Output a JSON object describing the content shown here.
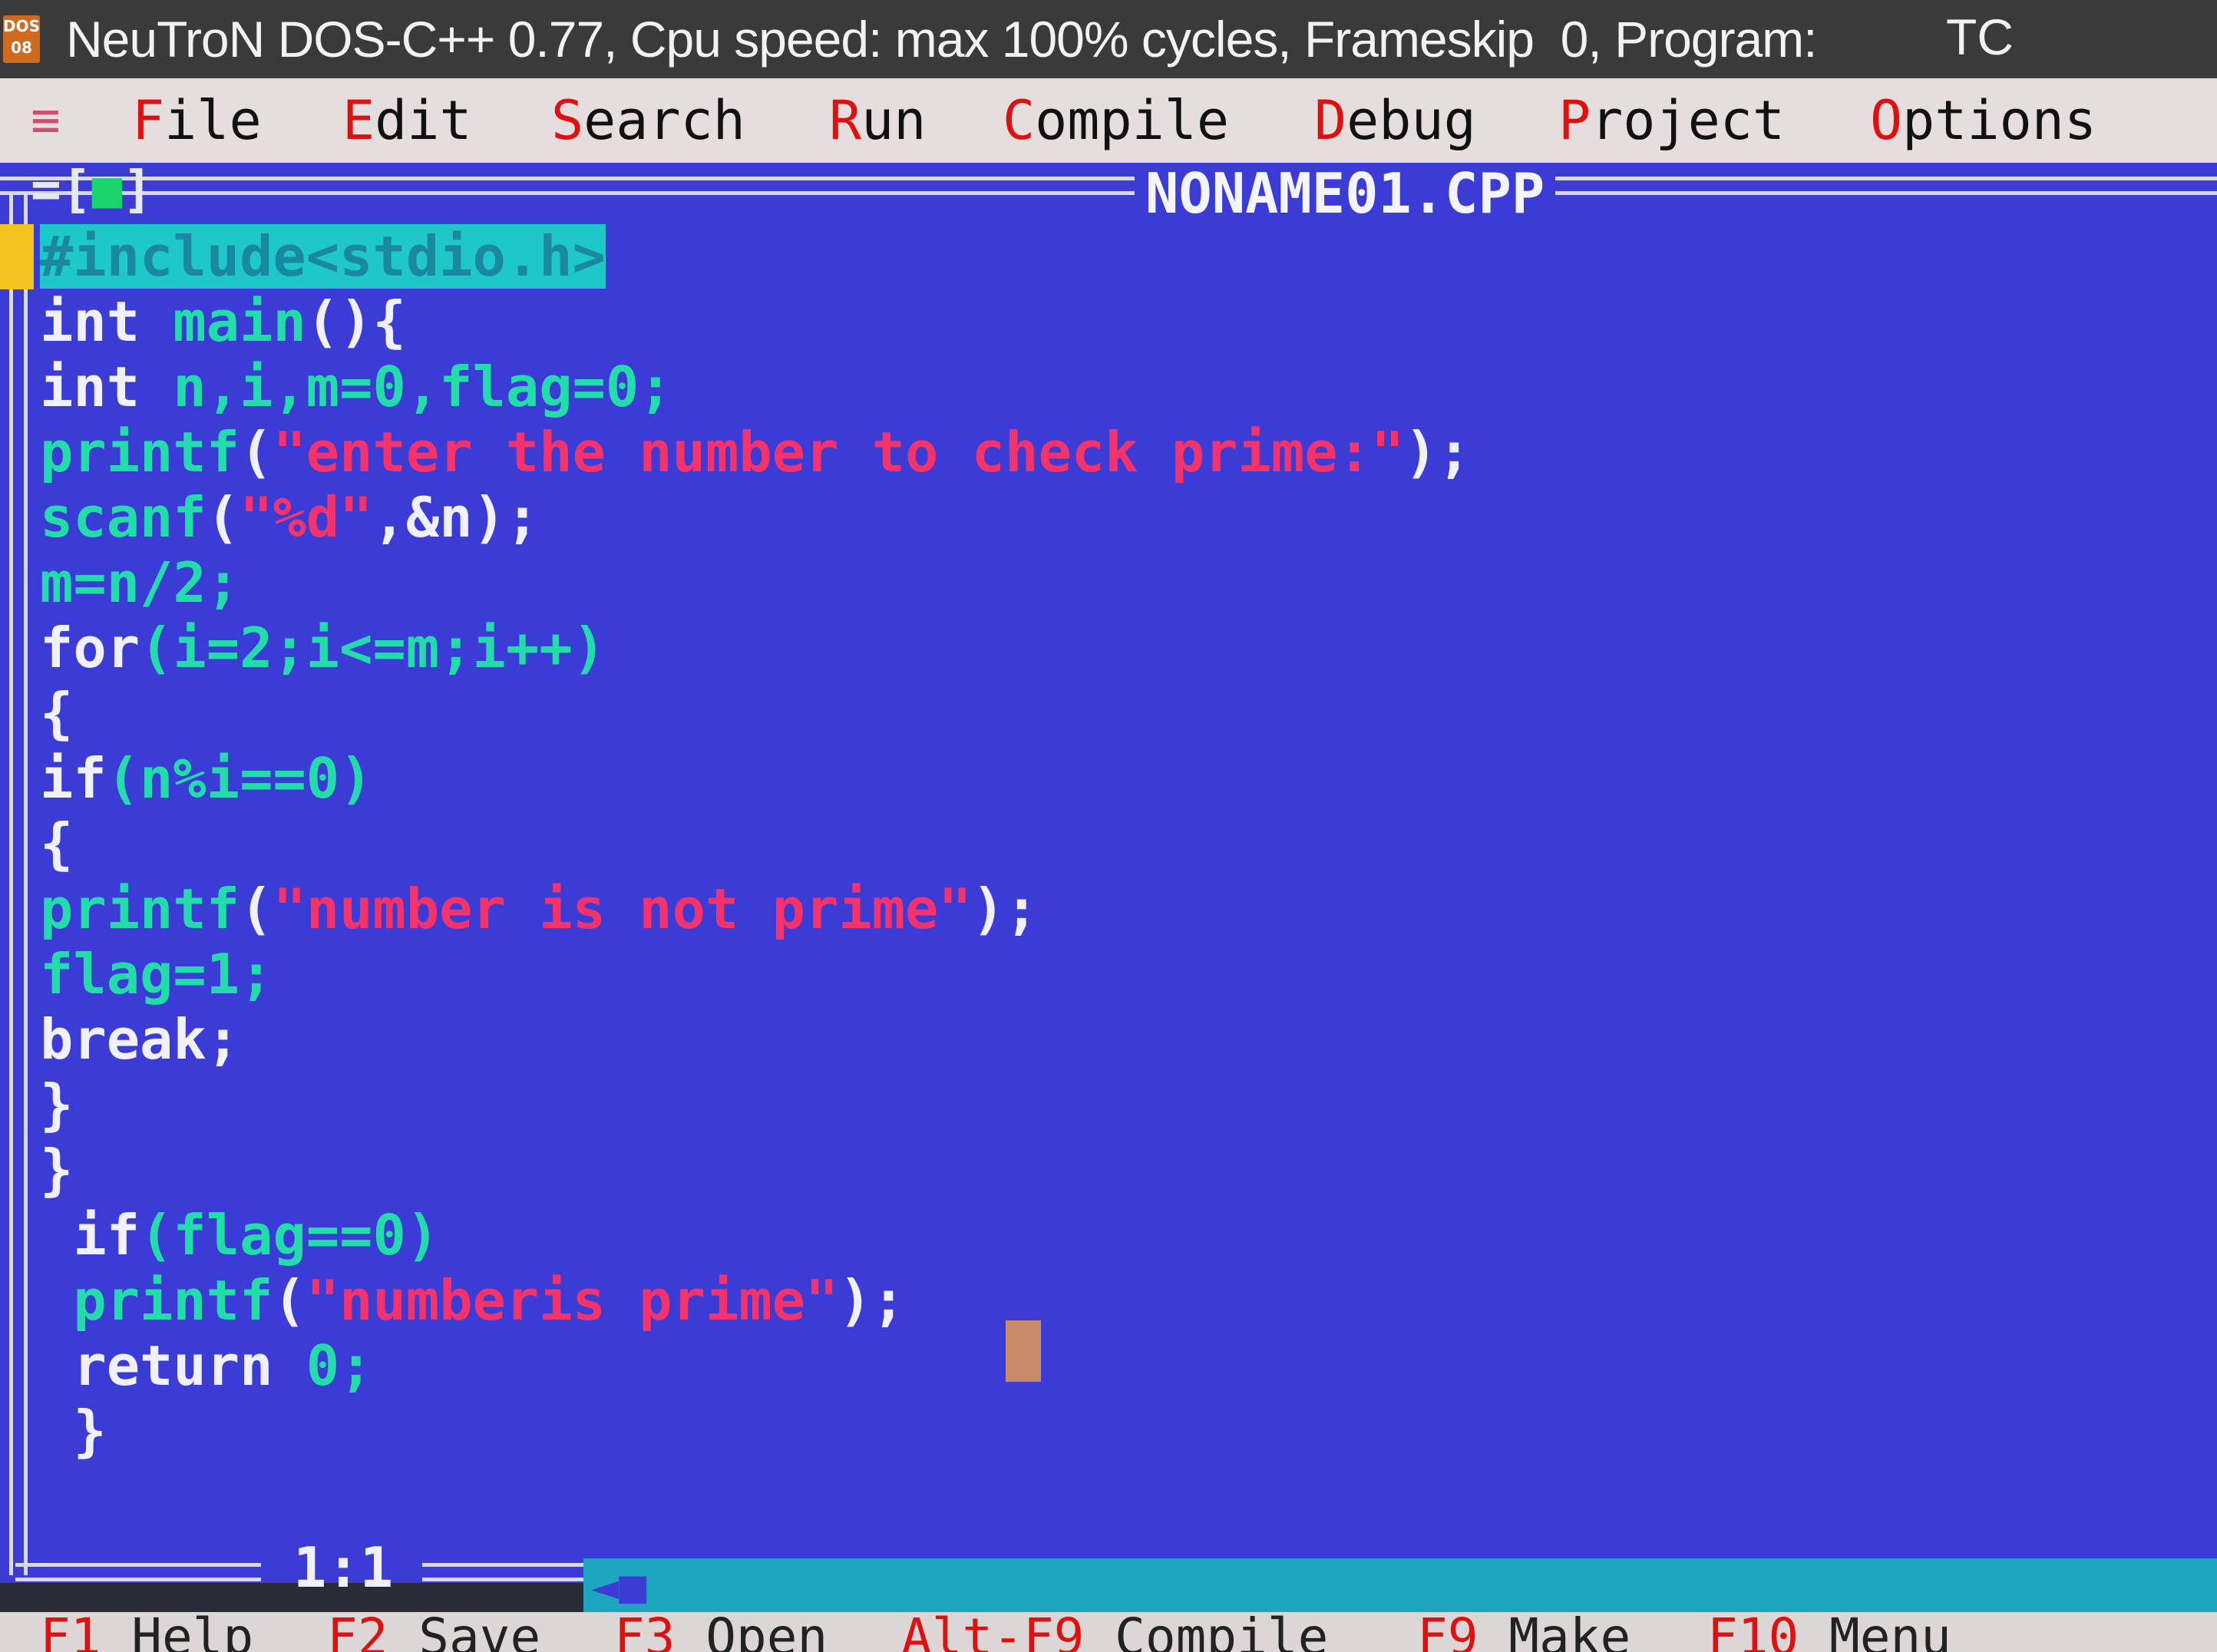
{
  "window": {
    "title": "NeuTroN DOS-C++ 0.77, Cpu speed: max 100% cycles, Frameskip  0, Program:",
    "program": "TC"
  },
  "menu": {
    "system": "≡",
    "items": [
      {
        "hot": "F",
        "rest": "ile"
      },
      {
        "hot": "E",
        "rest": "dit"
      },
      {
        "hot": "S",
        "rest": "earch"
      },
      {
        "hot": "R",
        "rest": "un"
      },
      {
        "hot": "C",
        "rest": "ompile"
      },
      {
        "hot": "D",
        "rest": "ebug"
      },
      {
        "hot": "P",
        "rest": "roject"
      },
      {
        "hot": "O",
        "rest": "ptions"
      }
    ]
  },
  "editor": {
    "close_button": {
      "left": "=[",
      "mark": "■",
      "right": "]"
    },
    "file_name": "NONAME01.CPP",
    "cursor_position": "1:1",
    "scroll_arrow": "◄■",
    "code_lines": [
      [
        {
          "t": "#include<stdio.h>",
          "c": "inc"
        }
      ],
      [
        {
          "t": "int",
          "c": "kw"
        },
        {
          "t": " main",
          "c": "id"
        },
        {
          "t": "(){",
          "c": "pun"
        }
      ],
      [
        {
          "t": "int",
          "c": "kw"
        },
        {
          "t": " n,i,m=0,flag=0;",
          "c": "id"
        }
      ],
      [
        {
          "t": "printf",
          "c": "id"
        },
        {
          "t": "(",
          "c": "pun"
        },
        {
          "t": "\"enter the number to check prime:\"",
          "c": "str"
        },
        {
          "t": ");",
          "c": "pun"
        }
      ],
      [
        {
          "t": "scanf",
          "c": "id"
        },
        {
          "t": "(",
          "c": "pun"
        },
        {
          "t": "\"%d\"",
          "c": "str"
        },
        {
          "t": ",&n);",
          "c": "pun"
        }
      ],
      [
        {
          "t": "m=n/2;",
          "c": "id"
        }
      ],
      [
        {
          "t": "for",
          "c": "kw"
        },
        {
          "t": "(i=2;i<=m;i++)",
          "c": "id"
        }
      ],
      [
        {
          "t": "{",
          "c": "pun"
        }
      ],
      [
        {
          "t": "if",
          "c": "kw"
        },
        {
          "t": "(n%i==0)",
          "c": "id"
        }
      ],
      [
        {
          "t": "{",
          "c": "pun"
        }
      ],
      [
        {
          "t": "printf",
          "c": "id"
        },
        {
          "t": "(",
          "c": "pun"
        },
        {
          "t": "\"number is not prime\"",
          "c": "str"
        },
        {
          "t": ");",
          "c": "pun"
        }
      ],
      [
        {
          "t": "flag=1;",
          "c": "id"
        }
      ],
      [
        {
          "t": "break",
          "c": "kw"
        },
        {
          "t": ";",
          "c": "pun"
        }
      ],
      [
        {
          "t": "}",
          "c": "pun"
        }
      ],
      [
        {
          "t": "}",
          "c": "pun"
        }
      ],
      [
        {
          "t": " if",
          "c": "kw"
        },
        {
          "t": "(flag==0)",
          "c": "id"
        }
      ],
      [
        {
          "t": " printf",
          "c": "id"
        },
        {
          "t": "(",
          "c": "pun"
        },
        {
          "t": "\"numberis prime\"",
          "c": "str"
        },
        {
          "t": ");",
          "c": "pun"
        }
      ],
      [
        {
          "t": " return",
          "c": "kw"
        },
        {
          "t": " 0;",
          "c": "id"
        }
      ],
      [
        {
          "t": " }",
          "c": "pun"
        }
      ]
    ]
  },
  "function_keys": [
    {
      "key": "F1",
      "label": "Help"
    },
    {
      "key": "F2",
      "label": "Save"
    },
    {
      "key": "F3",
      "label": "Open"
    },
    {
      "key": "Alt-F9",
      "label": "Compile"
    },
    {
      "key": "F9",
      "label": "Make"
    },
    {
      "key": "F10",
      "label": "Menu"
    }
  ],
  "colors": {
    "editor_bg": "#3b3cd6",
    "keyword": "#f0f0ff",
    "identifier": "#22dcaa",
    "string": "#f5336a",
    "hotkey": "#e01010",
    "menu_bg": "#e6dede"
  }
}
